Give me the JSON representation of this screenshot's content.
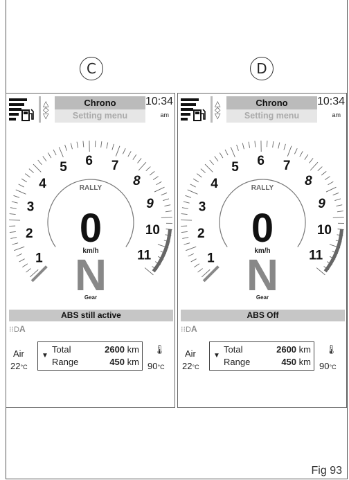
{
  "figure_label": "Fig 93",
  "panels": [
    {
      "id_label": "C",
      "menu_title": "Chrono",
      "menu_sub": "Setting menu",
      "time": "10:34",
      "ampm": "am",
      "mode": "RALLY",
      "speed": "0",
      "speed_unit": "km/h",
      "gear": "N",
      "gear_label": "Gear",
      "abs_status": "ABS still active",
      "light_mode": "A",
      "air_label": "Air",
      "air_temp": "22",
      "temp_unit": "°C",
      "trip_label1": "Total",
      "trip_value1": "2600",
      "trip_label2": "Range",
      "trip_value2": "450",
      "trip_unit": "km",
      "coolant_temp": "90",
      "rpm_labels": [
        "1",
        "2",
        "3",
        "4",
        "5",
        "6",
        "7",
        "8",
        "9",
        "10",
        "11"
      ]
    },
    {
      "id_label": "D",
      "menu_title": "Chrono",
      "menu_sub": "Setting menu",
      "time": "10:34",
      "ampm": "am",
      "mode": "RALLY",
      "speed": "0",
      "speed_unit": "km/h",
      "gear": "N",
      "gear_label": "Gear",
      "abs_status": "ABS Off",
      "light_mode": "A",
      "air_label": "Air",
      "air_temp": "22",
      "temp_unit": "°C",
      "trip_label1": "Total",
      "trip_value1": "2600",
      "trip_label2": "Range",
      "trip_value2": "450",
      "trip_unit": "km",
      "coolant_temp": "90",
      "rpm_labels": [
        "1",
        "2",
        "3",
        "4",
        "5",
        "6",
        "7",
        "8",
        "9",
        "10",
        "11"
      ]
    }
  ]
}
